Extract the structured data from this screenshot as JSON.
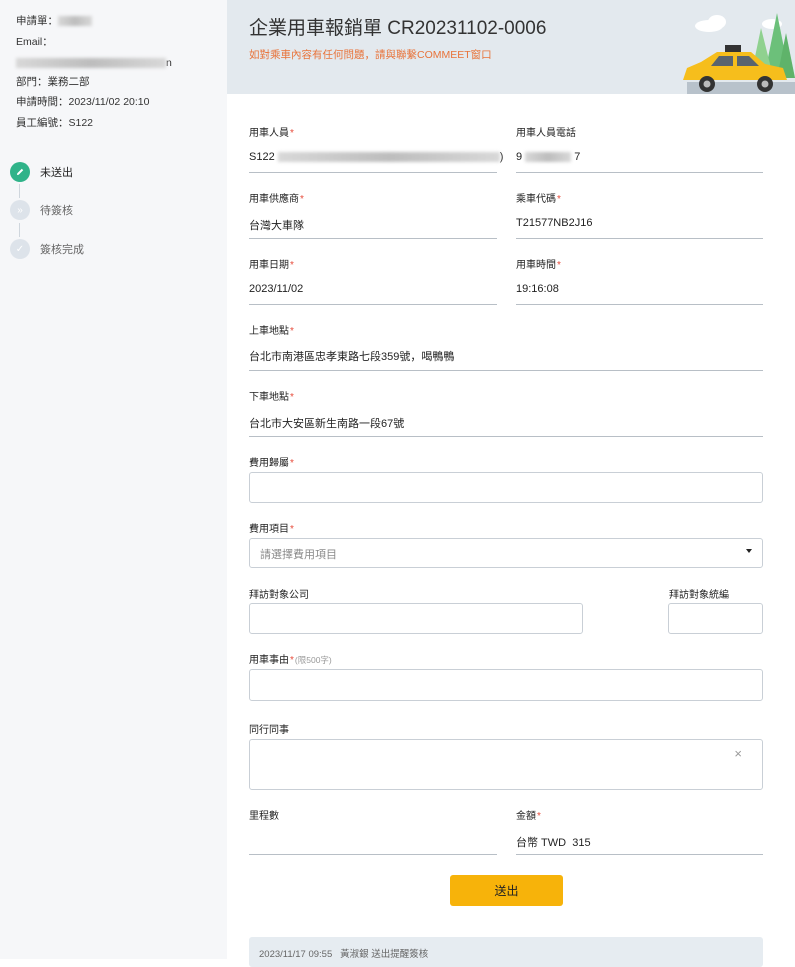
{
  "sidebar": {
    "request_no_label": "申請單：",
    "email_label": "Email：",
    "department": "部門：業務二部",
    "request_time": "申請時間：2023/11/02 20:10",
    "employee_no": "員工編號：S122",
    "email_tail": "n",
    "steps": [
      {
        "label": "未送出",
        "icon": "pencil-icon",
        "state": "active"
      },
      {
        "label": "待簽核",
        "icon": "double-chevron-icon",
        "state": "idle"
      },
      {
        "label": "簽核完成",
        "icon": "check-icon",
        "state": "idle"
      }
    ]
  },
  "header": {
    "title": "企業用車報銷單 CR20231102-0006",
    "notice": "如對乘車內容有任何問題，請與聯繫COMMEET窗口"
  },
  "form": {
    "rider": {
      "label": "用車人員",
      "value_prefix": "S122",
      "value_suffix": ")"
    },
    "rider_phone": {
      "label": "用車人員電話",
      "value_prefix": "9",
      "value_suffix": "7"
    },
    "supplier": {
      "label": "用車供應商",
      "value": "台灣大車隊"
    },
    "ride_code": {
      "label": "乘車代碼",
      "value": "T21577NB2J16"
    },
    "date": {
      "label": "用車日期",
      "value": "2023/11/02"
    },
    "time": {
      "label": "用車時間",
      "value": "19:16:08"
    },
    "pickup": {
      "label": "上車地點",
      "value": "台北市南港區忠孝東路七段359號，喝鴨鴨"
    },
    "dropoff": {
      "label": "下車地點",
      "value": "台北市大安區新生南路一段67號"
    },
    "cost_attribution": {
      "label": "費用歸屬",
      "value": ""
    },
    "cost_item": {
      "label": "費用項目",
      "placeholder": "請選擇費用項目"
    },
    "visit_company": {
      "label": "拜訪對象公司",
      "value": ""
    },
    "visit_tax_id": {
      "label": "拜訪對象統編",
      "value": ""
    },
    "reason": {
      "label": "用車事由",
      "hint": "(限500字)",
      "value": ""
    },
    "colleagues": {
      "label": "同行同事",
      "clear": "×"
    },
    "mileage": {
      "label": "里程數",
      "value": ""
    },
    "amount": {
      "label": "金額",
      "value": "台幣 TWD  315"
    },
    "required_mark": "*"
  },
  "submit_label": "送出",
  "log": {
    "text": "2023/11/17 09:55   黃淑銀 送出提醒簽核"
  },
  "colors": {
    "accent": "#f7b30a",
    "active_step": "#2fb389",
    "notice": "#e8733a",
    "header_bg": "#e3e9ee"
  }
}
